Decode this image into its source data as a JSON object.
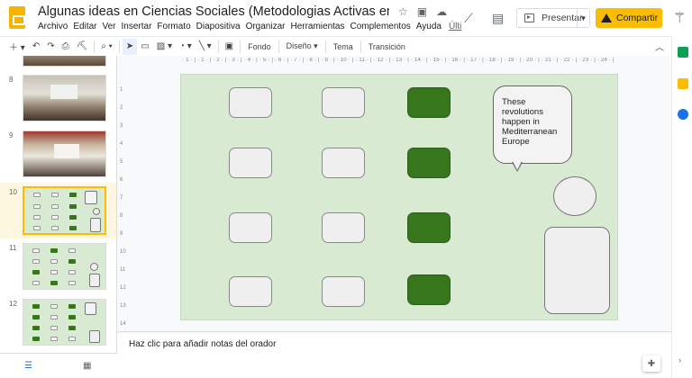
{
  "header": {
    "title": "Algunas ideas en Ciencias Sociales (Metodologias Activas en Tiempos de CO...",
    "last_edit": "Últi",
    "menu": [
      "Archivo",
      "Editar",
      "Ver",
      "Insertar",
      "Formato",
      "Diapositiva",
      "Organizar",
      "Herramientas",
      "Complementos",
      "Ayuda"
    ],
    "present_label": "Presentar",
    "share_label": "Compartir"
  },
  "toolbar": {
    "background_label": "Fondo",
    "layout_label": "Diseño",
    "theme_label": "Tema",
    "transition_label": "Transición"
  },
  "filmstrip": {
    "slides": [
      {
        "number": "8",
        "kind": "photo"
      },
      {
        "number": "9",
        "kind": "photo"
      },
      {
        "number": "10",
        "kind": "grid",
        "selected": true
      },
      {
        "number": "11",
        "kind": "grid"
      },
      {
        "number": "12",
        "kind": "grid"
      }
    ]
  },
  "slide": {
    "bubble_text": "These revolutions happen in Mediterranean Europe",
    "colors": {
      "background": "#d9ead3",
      "dark_box": "#38761d",
      "light_box": "#efefef"
    }
  },
  "ruler": {
    "h_marks": "· 1 · | · 1 · | · 2 · | · 3 · | · 4 · | · 5 · | · 6 · | · 7 · | · 8 · | · 9 · | · 10 · | · 11 · | · 12 · | · 13 · | · 14 · | · 15 · | · 16 · | · 17 · | · 18 · | · 19 · | · 20 · | · 21 · | · 22 · | · 23 · | · 24 · | · 25 ·",
    "v_marks": [
      "1",
      "2",
      "3",
      "4",
      "5",
      "6",
      "7",
      "8",
      "9",
      "10",
      "11",
      "12",
      "13",
      "14"
    ]
  },
  "notes": {
    "placeholder": "Haz clic para añadir notas del orador"
  },
  "accent_colors": {
    "share": "#fbbc04",
    "logo": "#f4b400"
  }
}
